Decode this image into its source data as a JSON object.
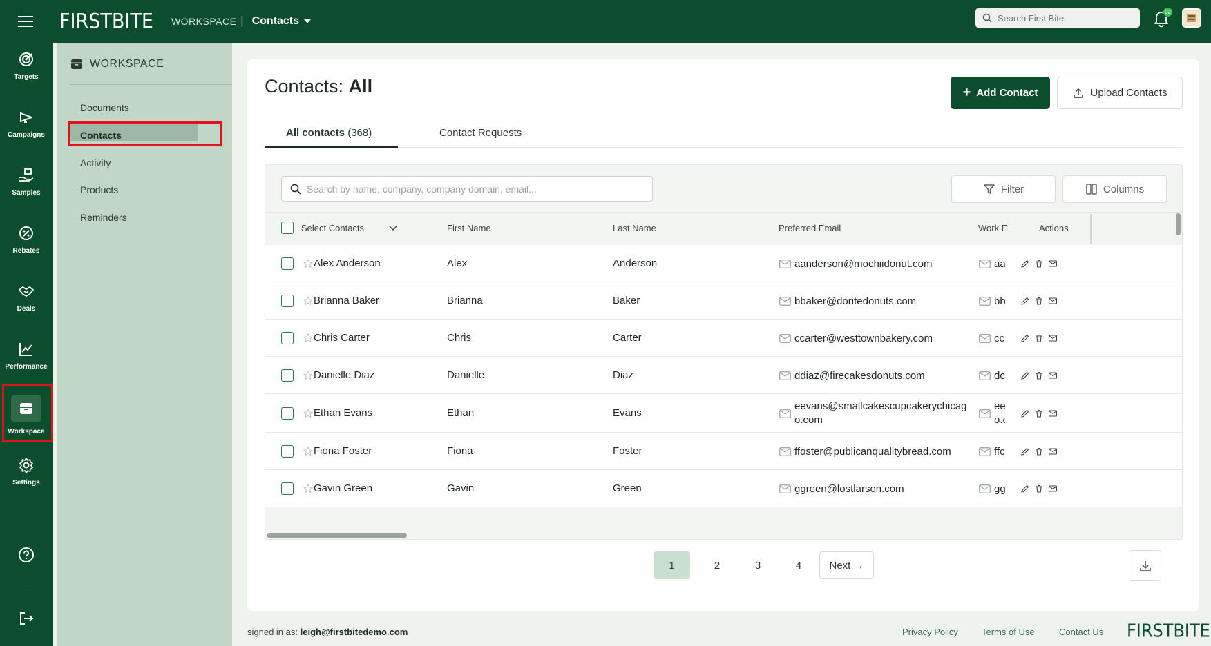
{
  "topbar": {
    "logo": "FIRSTBITE",
    "section_label": "WORKSPACE",
    "separator": "|",
    "current_page": "Contacts",
    "search_placeholder": "Search First Bite",
    "notification_count": "02"
  },
  "rail": {
    "items": [
      {
        "label": "Targets",
        "icon": "target-icon"
      },
      {
        "label": "Campaigns",
        "icon": "megaphone-icon"
      },
      {
        "label": "Samples",
        "icon": "hand-gift-icon"
      },
      {
        "label": "Rebates",
        "icon": "percent-badge-icon"
      },
      {
        "label": "Deals",
        "icon": "handshake-icon"
      },
      {
        "label": "Performance",
        "icon": "chart-line-icon"
      },
      {
        "label": "Workspace",
        "icon": "archive-box-icon"
      },
      {
        "label": "Settings",
        "icon": "gear-icon"
      }
    ],
    "active": "Workspace"
  },
  "subnav": {
    "title": "WORKSPACE",
    "items": [
      "Documents",
      "Contacts",
      "Activity",
      "Products",
      "Reminders"
    ],
    "active": "Contacts"
  },
  "main": {
    "title_prefix": "Contacts:",
    "title_filter": "All",
    "add_button": "Add Contact",
    "upload_button": "Upload Contacts",
    "tabs": {
      "all_label": "All contacts",
      "all_count": "(368)",
      "requests_label": "Contact Requests"
    },
    "search_placeholder": "Search by name, company, company domain, email...",
    "filter_label": "Filter",
    "columns_label": "Columns"
  },
  "table": {
    "headers": {
      "select": "Select Contacts",
      "first": "First Name",
      "last": "Last Name",
      "email": "Preferred Email",
      "work": "Work E",
      "actions": "Actions"
    },
    "rows": [
      {
        "full": "Alex Anderson",
        "first": "Alex",
        "last": "Anderson",
        "email": "aanderson@mochiidonut.com",
        "work": "aa"
      },
      {
        "full": "Brianna Baker",
        "first": "Brianna",
        "last": "Baker",
        "email": "bbaker@doritedonuts.com",
        "work": "bb"
      },
      {
        "full": "Chris Carter",
        "first": "Chris",
        "last": "Carter",
        "email": "ccarter@westtownbakery.com",
        "work": "cc"
      },
      {
        "full": "Danielle Diaz",
        "first": "Danielle",
        "last": "Diaz",
        "email": "ddiaz@firecakesdonuts.com",
        "work": "dc"
      },
      {
        "full": "Ethan Evans",
        "first": "Ethan",
        "last": "Evans",
        "email": "eevans@smallcakescupcakerychicag o.com",
        "work": "ee o.c"
      },
      {
        "full": "Fiona Foster",
        "first": "Fiona",
        "last": "Foster",
        "email": "ffoster@publicanqualitybread.com",
        "work": "ffc"
      },
      {
        "full": "Gavin Green",
        "first": "Gavin",
        "last": "Green",
        "email": "ggreen@lostlarson.com",
        "work": "gg"
      }
    ]
  },
  "pagination": {
    "pages": [
      "1",
      "2",
      "3",
      "4"
    ],
    "current": "1",
    "next_label": "Next →"
  },
  "footer": {
    "signed_prefix": "signed in as:",
    "signed_user": "leigh@firstbitedemo.com",
    "links": [
      "Privacy Policy",
      "Terms of Use",
      "Contact Us"
    ],
    "logo": "FIRSTBITE"
  },
  "colors": {
    "brand_dark": "#0b4d2c",
    "subnav_bg": "#c2d6c7",
    "highlight_outline": "#e0121b"
  }
}
